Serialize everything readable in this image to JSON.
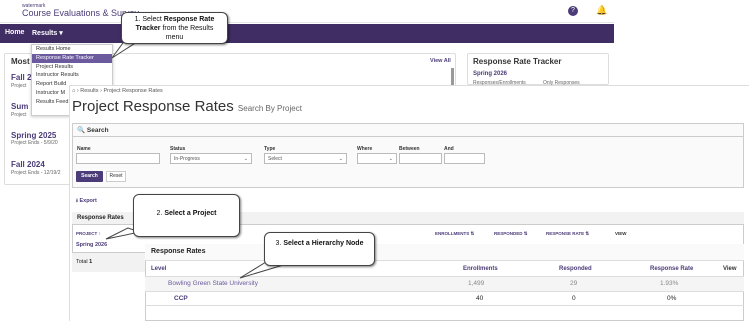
{
  "app": {
    "logo_sub": "watermark",
    "title": "Course Evaluations & Survey"
  },
  "nav": {
    "home": "Home",
    "results": "Results ▾"
  },
  "results_menu": {
    "items": [
      "Results Home",
      "Response Rate Tracker",
      "Project Results",
      "Instructor Results",
      "Report Build",
      "Instructor M",
      "Results Feed"
    ],
    "active_index": 1
  },
  "background": {
    "most_panel_title": "Most",
    "view_all": "View All",
    "projects": [
      {
        "name": "Fall 2",
        "meta": "Project"
      },
      {
        "name": "Sum",
        "meta": "Project"
      },
      {
        "name": "Spring 2025",
        "meta": "Project Ends - 5/9/20"
      },
      {
        "name": "Fall 2024",
        "meta": "Project Ends - 12/19/2"
      }
    ],
    "tracker_title": "Response Rate Tracker",
    "tracker_term": "Spring 2026",
    "tracker_cols": [
      "Responses/Enrollments",
      "Only Responses"
    ]
  },
  "breadcrumb": {
    "home": "Results",
    "current": "Project Response Rates"
  },
  "page": {
    "title": "Project Response Rates",
    "subtitle": "Search By Project"
  },
  "search": {
    "heading": "Search",
    "labels": {
      "name": "Name",
      "status": "Status",
      "type": "Type",
      "where": "Where",
      "between": "Between",
      "and": "And"
    },
    "status_value": "In-Progress",
    "type_value": "Select",
    "search_btn": "Search",
    "reset_btn": "Reset"
  },
  "export": "Export",
  "response_rates": {
    "heading": "Response Rates",
    "columns": [
      "PROJECT ↑",
      "ENROLLMENTS ⇅",
      "RESPONDED ⇅",
      "RESPONSE RATE ⇅",
      "VIEW"
    ],
    "first_project": "Spring 2026",
    "total_label": "Total",
    "total_value": "1"
  },
  "hierarchy": {
    "heading": "Response Rates",
    "columns": [
      "Level",
      "Enrollments",
      "Responded",
      "Response Rate",
      "View"
    ],
    "rows": [
      {
        "level": "Bowling Green State University",
        "enrollments": "1,499",
        "responded": "29",
        "rate": "1.93%"
      },
      {
        "level": "CCP",
        "enrollments": "40",
        "responded": "0",
        "rate": "0%"
      }
    ]
  },
  "callouts": {
    "one_a": "1. Select ",
    "one_b": "Response Rate Tracker",
    "one_c": " from the Results menu",
    "two_a": "2. ",
    "two_b": "Select a Project",
    "three_a": "3. ",
    "three_b": "Select a Hierarchy Node"
  }
}
